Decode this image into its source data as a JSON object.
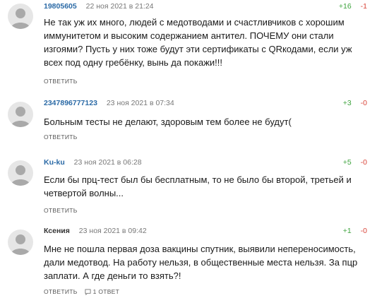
{
  "comments": [
    {
      "author": "19805605",
      "date": "22 ноя 2021 в 21:24",
      "votes_up": "+16",
      "votes_down": "-1",
      "text": "Не так уж их много, людей с медотводами и счастливчиков с хорошим иммунитетом и высоким содержанием антител. ПОЧЕМУ они стали изгоями? Пусть у них тоже будут эти сертификаты с QRкодами, если уж всех под одну гребёнку, вынь да покажи!!!",
      "reply_label": "ОТВЕТИТЬ"
    },
    {
      "author": "2347896777123",
      "date": "23 ноя 2021 в 07:34",
      "votes_up": "+3",
      "votes_down": "-0",
      "text": "Больным тесты не делают, здоровым тем более не будут(",
      "reply_label": "ОТВЕТИТЬ"
    },
    {
      "author": "Ku-ku",
      "date": "23 ноя 2021 в 06:28",
      "votes_up": "+5",
      "votes_down": "-0",
      "text": "Если бы прц-тест был бы бесплатным, то не было бы второй, третьей и четвертой волны...",
      "reply_label": "ОТВЕТИТЬ"
    },
    {
      "author": "Ксения",
      "date": "23 ноя 2021 в 09:42",
      "votes_up": "+1",
      "votes_down": "-0",
      "text": "Мне не пошла первая доза вакцины спутник, выявили непереносимость, дали медотвод. На работу нельзя, в общественные места нельзя. За пцр заплати. А где деньги то взять?!",
      "reply_label": "ОТВЕТИТЬ",
      "replies_label": "1 ОТВЕТ"
    }
  ],
  "colors": {
    "author_link": "#2b6aa6",
    "vote_up": "#3da33d",
    "vote_down": "#d9453a",
    "avatar_bg": "#e6e6e6",
    "avatar_fg": "#a9a9a9"
  },
  "icons": {
    "avatar": "user-silhouette-icon",
    "replies": "comment-bubble-icon"
  }
}
